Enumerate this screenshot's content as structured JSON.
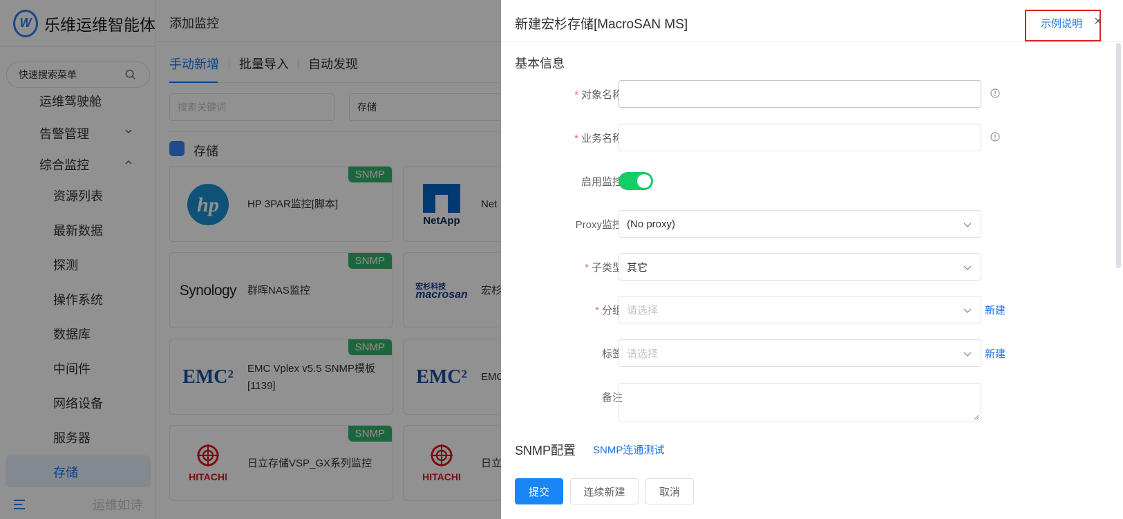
{
  "sidebar": {
    "brand": "乐维运维智能体",
    "search_placeholder": "快速搜索菜单",
    "items": [
      {
        "label": "运维驾驶舱"
      },
      {
        "label": "告警管理"
      },
      {
        "label": "综合监控"
      },
      {
        "label": "资源列表"
      },
      {
        "label": "最新数据"
      },
      {
        "label": "探测"
      },
      {
        "label": "操作系统"
      },
      {
        "label": "数据库"
      },
      {
        "label": "中间件"
      },
      {
        "label": "网络设备"
      },
      {
        "label": "服务器"
      },
      {
        "label": "存储"
      }
    ],
    "footer_text": "运维如诗"
  },
  "panel": {
    "title": "添加监控",
    "tabs": [
      "手动新增",
      "批量导入",
      "自动发现"
    ],
    "keyword_placeholder": "搜索关键词",
    "category_value": "存储",
    "section_title": "存储",
    "cards": [
      {
        "logo": "hp",
        "name": "HP 3PAR监控[脚本]",
        "badge": "SNMP"
      },
      {
        "logo": "NetApp",
        "name": "Net"
      },
      {
        "logo": "Synology",
        "name": "群晖NAS监控",
        "badge": "SNMP"
      },
      {
        "logo": "macrosan",
        "name": "宏杉"
      },
      {
        "logo": "EMC²",
        "name": "EMC Vplex v5.5 SNMP模板[1139]",
        "badge": "SNMP"
      },
      {
        "logo": "EMC²",
        "name": "EMC"
      },
      {
        "logo": "HITACHI",
        "name": "日立存储VSP_GX系列监控",
        "badge": "SNMP"
      },
      {
        "logo": "HITACHI",
        "name": "日立"
      }
    ],
    "macrosan_cn": "宏杉科技"
  },
  "drawer": {
    "title": "新建宏杉存储[MacroSAN MS]",
    "help_link": "示例说明",
    "close": "×",
    "basic_section": "基本信息",
    "fields": {
      "object_name": {
        "label": "对象名称",
        "value": ""
      },
      "business_name": {
        "label": "业务名称",
        "value": ""
      },
      "enable_monitor": {
        "label": "启用监控",
        "on": true
      },
      "proxy": {
        "label": "Proxy监控",
        "value": "(No proxy)"
      },
      "subtype": {
        "label": "子类型",
        "value": "其它"
      },
      "group": {
        "label": "分组",
        "placeholder": "请选择",
        "new_link": "新建"
      },
      "tags": {
        "label": "标签",
        "placeholder": "请选择",
        "new_link": "新建"
      },
      "remark": {
        "label": "备注"
      }
    },
    "snmp_section": "SNMP配置",
    "snmp_test_link": "SNMP连通测试",
    "buttons": {
      "submit": "提交",
      "continue": "连续新建",
      "cancel": "取消"
    }
  },
  "colors": {
    "accent": "#1a73e8",
    "success": "#13ce66",
    "badge": "#34b36b",
    "required": "#f56c6c",
    "highlight": "#e02020"
  }
}
